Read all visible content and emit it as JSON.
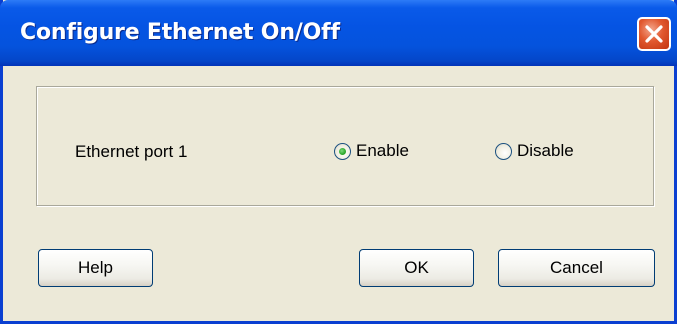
{
  "window": {
    "title": "Configure Ethernet On/Off",
    "close_icon": "close-icon",
    "accent_color": "#0554e3",
    "close_color": "#e1582f"
  },
  "port": {
    "label": "Ethernet port 1",
    "selected": "Enable",
    "options": [
      {
        "label": "Enable",
        "checked": true
      },
      {
        "label": "Disable",
        "checked": false
      }
    ]
  },
  "buttons": {
    "help": "Help",
    "ok": "OK",
    "cancel": "Cancel"
  }
}
